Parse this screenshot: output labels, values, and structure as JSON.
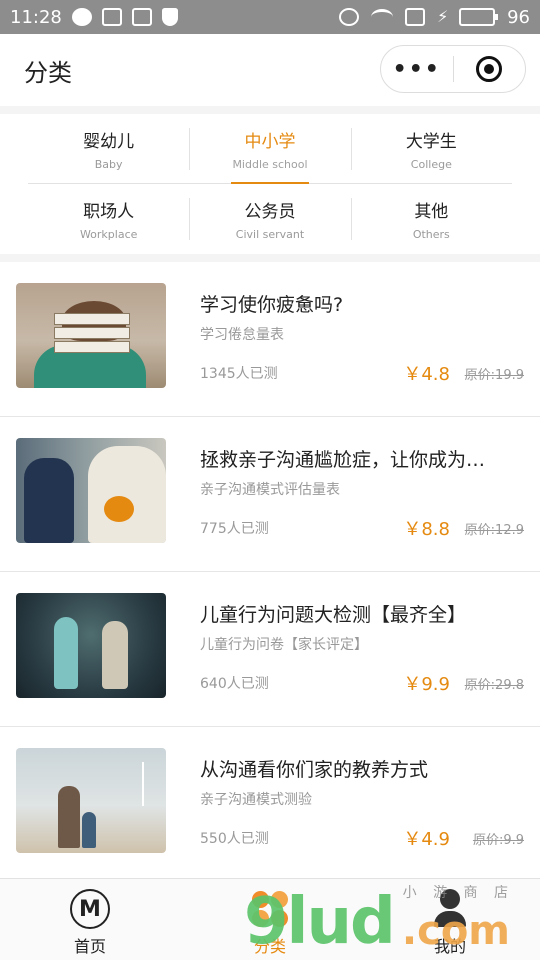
{
  "status_bar": {
    "time": "11:28",
    "battery_percent": "96"
  },
  "header": {
    "title": "分类",
    "more_label": "•••"
  },
  "categories": [
    [
      {
        "zh": "婴幼儿",
        "en": "Baby",
        "active": false
      },
      {
        "zh": "中小学",
        "en": "Middle school",
        "active": true
      },
      {
        "zh": "大学生",
        "en": "College",
        "active": false
      }
    ],
    [
      {
        "zh": "职场人",
        "en": "Workplace",
        "active": false
      },
      {
        "zh": "公务员",
        "en": "Civil servant",
        "active": false
      },
      {
        "zh": "其他",
        "en": "Others",
        "active": false
      }
    ]
  ],
  "items": [
    {
      "title": "学习使你疲惫吗?",
      "subtitle": "学习倦怠量表",
      "count": "1345人已测",
      "price": "￥4.8",
      "original": "原价:19.9"
    },
    {
      "title": "拯救亲子沟通尴尬症，让你成为…",
      "subtitle": "亲子沟通模式评估量表",
      "count": "775人已测",
      "price": "￥8.8",
      "original": "原价:12.9"
    },
    {
      "title": "儿童行为问题大检测【最齐全】",
      "subtitle": "儿童行为问卷【家长评定】",
      "count": "640人已测",
      "price": "￥9.9",
      "original": "原价:29.8"
    },
    {
      "title": "从沟通看你们家的教养方式",
      "subtitle": "亲子沟通模式测验",
      "count": "550人已测",
      "price": "￥4.9",
      "original": "原价:9.9"
    }
  ],
  "tabs": [
    {
      "label": "首页",
      "active": false
    },
    {
      "label": "分类",
      "active": true
    },
    {
      "label": "我的",
      "active": false
    }
  ],
  "watermark": {
    "main": "9lud",
    "suffix": ".com",
    "handwriting": "小 游 商 店"
  },
  "colors": {
    "accent": "#e58a11",
    "status_bar_bg": "#8d8d8d"
  }
}
